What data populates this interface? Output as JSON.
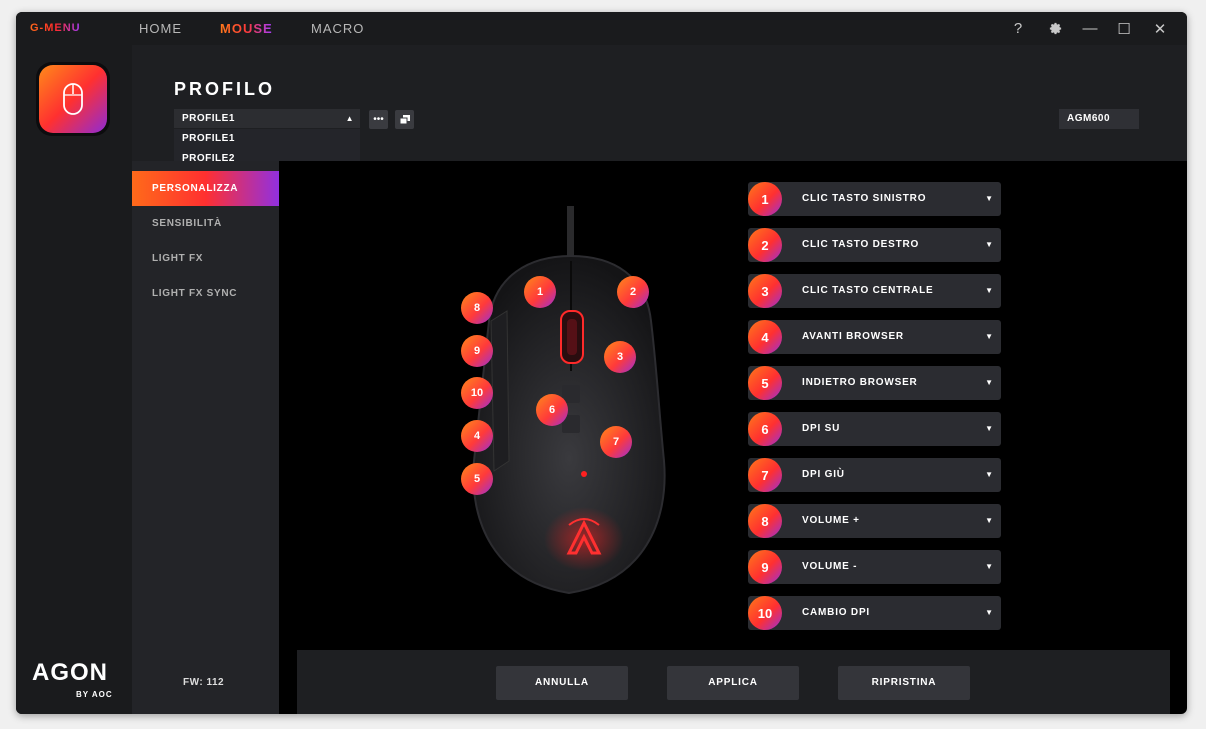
{
  "app": {
    "logo": "G-MENU",
    "nav": [
      {
        "label": "HOME"
      },
      {
        "label": "MOUSE"
      },
      {
        "label": "MACRO"
      }
    ],
    "controls": {
      "help": "?",
      "settings": "⚙",
      "minimize": "—",
      "maximize": "☐",
      "close": "✕"
    }
  },
  "brand": {
    "name": "AGON",
    "sub": "BY AOC"
  },
  "header": {
    "title": "PROFILO",
    "profile_selected": "PROFILE1",
    "profile_options": [
      "PROFILE1",
      "PROFILE2"
    ],
    "more_button": "•••",
    "model": "AGM600"
  },
  "submenu": {
    "items": [
      {
        "label": "PERSONALIZZA",
        "active": true
      },
      {
        "label": "SENSIBILITÀ",
        "active": false
      },
      {
        "label": "LIGHT FX",
        "active": false
      },
      {
        "label": "LIGHT FX SYNC",
        "active": false
      }
    ],
    "firmware": "FW: 112"
  },
  "callouts": [
    "1",
    "2",
    "3",
    "4",
    "5",
    "6",
    "7",
    "8",
    "9",
    "10"
  ],
  "assignments": [
    {
      "num": "1",
      "label": "CLIC TASTO SINISTRO"
    },
    {
      "num": "2",
      "label": "CLIC TASTO DESTRO"
    },
    {
      "num": "3",
      "label": "CLIC TASTO CENTRALE"
    },
    {
      "num": "4",
      "label": "AVANTI BROWSER"
    },
    {
      "num": "5",
      "label": "INDIETRO BROWSER"
    },
    {
      "num": "6",
      "label": "DPI SU"
    },
    {
      "num": "7",
      "label": "DPI GIÙ"
    },
    {
      "num": "8",
      "label": "VOLUME +"
    },
    {
      "num": "9",
      "label": "VOLUME -"
    },
    {
      "num": "10",
      "label": "CAMBIO DPI"
    }
  ],
  "dropdown_arrow": "▼",
  "footer": {
    "cancel": "ANNULLA",
    "apply": "APPLICA",
    "reset": "RIPRISTINA"
  },
  "colors": {
    "accent_orange": "#ff6a1a",
    "accent_red": "#ff3030",
    "accent_purple": "#9130e0",
    "panel": "#1e1f22"
  }
}
